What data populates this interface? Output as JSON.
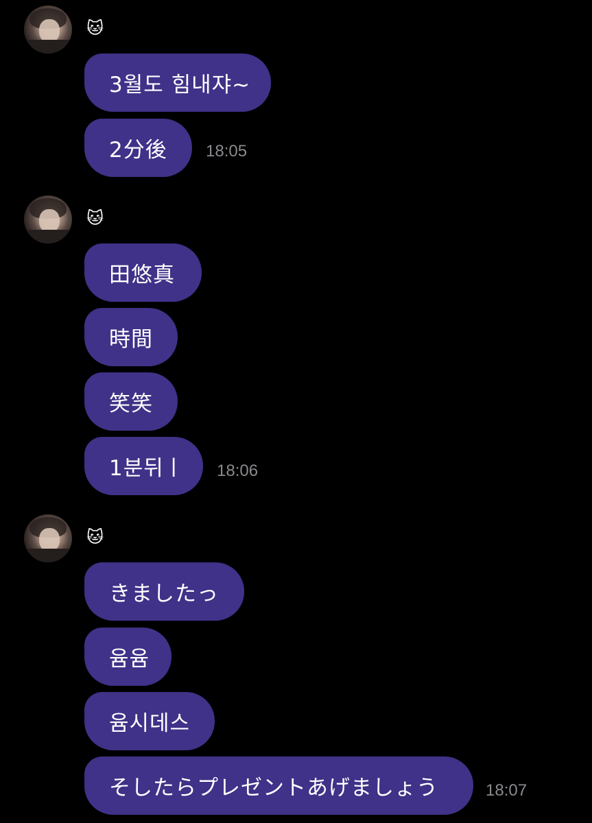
{
  "colors": {
    "background": "#000000",
    "bubble": "#3f3288",
    "text": "#ffffff",
    "timestamp": "#8a8a8f"
  },
  "groups": [
    {
      "sender_icon": "cat-face-emoji",
      "sender": "🐱",
      "messages": [
        "3월도 힘내쟈~",
        "2分後"
      ],
      "time": "18:05"
    },
    {
      "sender_icon": "cat-face-emoji",
      "sender": "🐱",
      "messages": [
        "田悠真",
        "時間",
        "笑笑",
        "1분뒤ㅣ"
      ],
      "time": "18:06"
    },
    {
      "sender_icon": "cat-face-emoji",
      "sender": "🐱",
      "messages": [
        "きましたっ",
        "윰윰",
        "윰시데스",
        "そしたらプレゼントあげましょう"
      ],
      "time": "18:07"
    }
  ]
}
